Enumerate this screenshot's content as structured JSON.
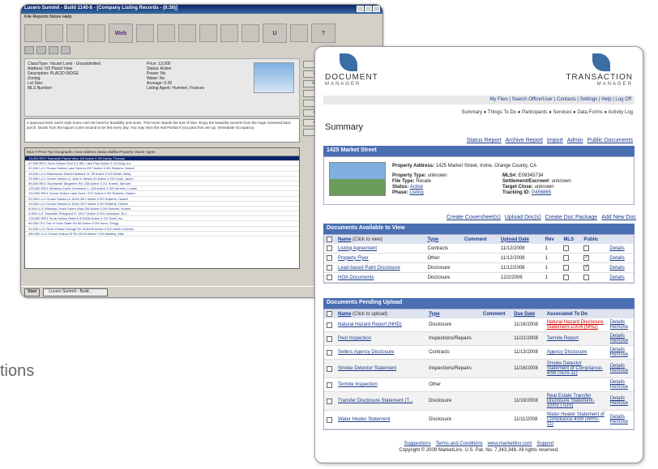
{
  "caption": "tions",
  "back_window": {
    "title": "Lucero Summit - Build 1140-8 - [Company Listing Records - (8:36)]",
    "menu": "File  Reports  Notes  Help",
    "listing": {
      "class_type": "Class/Type: Vacant Land - Unsubdivided",
      "address": "Address: 5/3 Placid View",
      "description": "Description: PLACID RIDGE",
      "zoning": "Zoning:",
      "lot_size": "Lot Size:",
      "mls_number": "MLS Number:",
      "price": "Price: 13,000",
      "status": "Status: Active",
      "power": "Power: No",
      "water": "Water: No",
      "acreage": "Acreage: 0.00",
      "listing_agent": "Listing Agent: Hummer, Frances"
    },
    "description_text": "A spacious brick ranch style home can't be beat for durability and looks. This home stands the test of time. Enjoy the beautiful sunsets from the huge screened back porch. Ducks from the lagoon come around to be fed every day. You may miss the real Florida if you pass this one up. Immediate Occupancy.",
    "grid_headers": "MLS #   Price   Typ   Geographic Area   Address   Status   Bd/Ba   Property Owner   Agent",
    "rows": [
      "13,000  RE/1  Townside   Placid View, 5/3  Active  0  0/0  Darby, Thomas",
      "67,500  RE/1  Snob Hollow  First 5-1785, Lake Plac  Active  2  1/0  King, Ira",
      "22,900  LL/1  Goose Hollow  Lake Sereno 29/7  Active  0  0/0  Roberts, Hubert",
      "15,000  LL/1  Warehouse District  Mallard Ct. 39  Active  0  0/0  White, Betty",
      "79,900  LL/1  Goose Hollow  Lk Jose In Westn 25  Active  3  2/0  Cook, Jason",
      "98,500  RE/1  Southwest  Tangerine Rd. 236  Active  3  2/1  Sneed, Samuel",
      "125,900  RE/1  Whiskey Creek  Crestview 1, 128  Active  3  3/0  Hendrix, Louise",
      "122,000  RE/1  Goose Hollow  Lake Drive, 27/7  Active  0  0/0  Roberts, Hubert",
      "22,900  LL/1  Goose Hollow  Lk Drive 39/7  Active  0  0/0  Roberts, Hubert",
      "19,500  LL/1  Goose Hollow  Lk Drive 39/7  Active  0  0/0  Roberts, Hubert",
      "8,500  LL/1  Whiskey Creek  Sierra Vista 3/6  Active  0  0/0  Roberts, Hubert",
      "9,500  LL/1  Townside  Sheppard R. 16/17  Active  0  0/0  Levasseur, M.J.",
      "178,000  RE/1  Snob Hollow  Delta A 9/25/28  Active  3  2/0  Toest, Inc.",
      "65,000  CI/1  Out of Town  State Rd 66  Active  0  0/0  Hunn, Gregg",
      "31,500  LL/1  Snob Hollow  Orange Rd 31/5426  Active  0  0/0  Ulloth, Dolores",
      "450,000  LL/1  Goose Hollow  SI Rd 421/5  Active  0  0/0  Mantley, Mac"
    ],
    "side_buttons": [
      "Listing",
      "Lookup",
      "To Sheet",
      "MLS",
      "TM",
      "Default",
      "Loan C",
      "Hide"
    ],
    "taskbar": {
      "start": "Start",
      "app": "Lucero Summit - Build..."
    }
  },
  "front": {
    "logo_left": {
      "line1": "DOCUMENT",
      "line2": "MANAGER"
    },
    "logo_right": {
      "line1": "TRANSACTION",
      "line2": "MANAGER"
    },
    "top_nav": "My Files | Search Office/User | Contacts | Settings | Help | Log Off",
    "crumbs": "Summary ● Things To Do ● Participants ● Services ● Data Forms ● Activity Log",
    "page_title": "Summary",
    "report_links": [
      "Status Report",
      "Archive Report",
      "Import",
      "Admin",
      "Public Documents"
    ],
    "property": {
      "heading": "1425 Market Street",
      "address_label": "Property Address:",
      "address": "1425 Market Street, Irvine, Orange County, CA",
      "type_label": "Property Type:",
      "type": "unknown",
      "file_label": "File Type:",
      "file": "Resale",
      "status_label": "Status:",
      "status": "Active",
      "phase_label": "Phase:",
      "phase": "Listing",
      "mls_label": "MLS#:",
      "mls": "E09345734",
      "settlement_label": "Settlement/Escrow#:",
      "settlement": "unknown",
      "target_label": "Target Close:",
      "target": "unknown",
      "tracking_label": "Tracking ID:",
      "tracking": "P456865"
    },
    "actions": [
      "Create Coversheet(s)",
      "Upload Doc(s)",
      "Create Doc Package",
      "Add New Doc"
    ],
    "avail": {
      "heading": "Documents Available to View",
      "cols": {
        "name": "Name",
        "name_hint": "(Click to view)",
        "type": "Type",
        "comment": "Comment",
        "date": "Upload Date",
        "rev": "Rev",
        "mls": "MLS",
        "public": "Public"
      },
      "rows": [
        {
          "name": "Listing Agreement",
          "type": "Contracts",
          "date": "11/12/2008",
          "rev": "1",
          "mls": false,
          "pub": false,
          "d": "Details"
        },
        {
          "name": "Property Flyer",
          "type": "Other",
          "date": "11/12/2008",
          "rev": "1",
          "mls": false,
          "pub": true,
          "d": "Details"
        },
        {
          "name": "Lead-based Paint Disclosure",
          "type": "Disclosure",
          "date": "11/12/2008",
          "rev": "1",
          "mls": false,
          "pub": true,
          "d": "Details"
        },
        {
          "name": "HOA Documents",
          "type": "Disclosure",
          "date": "12/2/2008",
          "rev": "1",
          "mls": false,
          "pub": false,
          "d": "Details"
        }
      ]
    },
    "pending": {
      "heading": "Documents Pending Upload",
      "cols": {
        "name": "Name",
        "name_hint": "(Click to upload)",
        "type": "Type",
        "comment": "Comment",
        "date": "Due Date",
        "assoc": "Associated To Do"
      },
      "rows": [
        {
          "name": "Natural Hazard Report (NHD)",
          "type": "Disclosure",
          "date": "11/16/2008",
          "assoc": "Natural Hazard Disclosure Statement-10/04 (NHD)",
          "red": true
        },
        {
          "name": "Pest Inspection",
          "type": "Inspections/Repairs",
          "date": "11/21/2008",
          "assoc": "Termite Report",
          "red": false
        },
        {
          "name": "Sellers Agency Disclosure",
          "type": "Contracts",
          "date": "11/13/2008",
          "assoc": "Agency Disclosure",
          "red": false
        },
        {
          "name": "Smoke Detector Statement",
          "type": "Inspections/Repairs",
          "date": "11/16/2008",
          "assoc": "Smoke Detector Statement of Compliance- 4/99 (SDS-11)",
          "red": false
        },
        {
          "name": "Termite Inspection",
          "type": "Other",
          "date": "",
          "assoc": "",
          "red": false
        },
        {
          "name": "Transfer Disclosure Statement (T...",
          "type": "Disclosure",
          "date": "11/19/2008",
          "assoc": "Real Estate Transfer Disclosure Statement-10/03 (TDS)",
          "red": false
        },
        {
          "name": "Water Heater Statement",
          "type": "Disclosure",
          "date": "11/11/2008",
          "assoc": "Water Heater Statement of Compliance-4/99 (WHS-11)",
          "red": false
        }
      ],
      "details": "Details",
      "remove": "Remove"
    },
    "footer_links": [
      "Suggestions",
      "Terms and Conditions",
      "www.marketlinx.com",
      "Support"
    ],
    "copyright": "Copyright © 2009 MarketLinx. U.S. Pat. No. 7,343,348. All rights reserved."
  }
}
